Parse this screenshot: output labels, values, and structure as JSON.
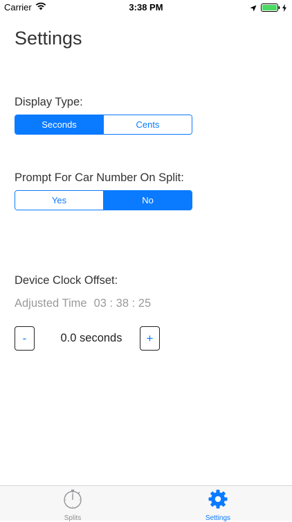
{
  "status_bar": {
    "carrier": "Carrier",
    "time": "3:38 PM"
  },
  "page": {
    "title": "Settings"
  },
  "display_type": {
    "label": "Display Type:",
    "options": [
      "Seconds",
      "Cents"
    ],
    "selected": "Seconds"
  },
  "prompt_car_number": {
    "label": "Prompt For Car Number On Split:",
    "options": [
      "Yes",
      "No"
    ],
    "selected": "No"
  },
  "clock_offset": {
    "label": "Device Clock Offset:",
    "adjusted_label": "Adjusted Time",
    "adjusted_time": "03 : 38 : 25",
    "decrement_label": "-",
    "increment_label": "+",
    "value": "0.0 seconds"
  },
  "tab_bar": {
    "tabs": [
      {
        "label": "Splits",
        "icon": "stopwatch-icon",
        "active": false
      },
      {
        "label": "Settings",
        "icon": "gear-icon",
        "active": true
      }
    ]
  },
  "colors": {
    "accent": "#0a7aff",
    "text": "#333333",
    "muted": "#9a9a9a",
    "tab_inactive": "#8e8e93"
  }
}
